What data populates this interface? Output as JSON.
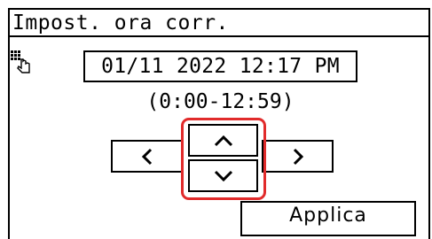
{
  "header": {
    "title": "Impost. ora corr."
  },
  "datetime": {
    "value": "01/11 2022 12:17 PM",
    "range": "(0:00-12:59)"
  },
  "controls": {
    "left": {
      "icon": "chevron-left-icon"
    },
    "right": {
      "icon": "chevron-right-icon"
    },
    "up": {
      "icon": "chevron-up-icon"
    },
    "down": {
      "icon": "chevron-down-icon"
    },
    "keypad_icon": "keypad-hand-icon"
  },
  "footer": {
    "apply_label": "Applica"
  },
  "colors": {
    "focus": "#e12b2b",
    "text": "#000000",
    "background": "#ffffff"
  }
}
